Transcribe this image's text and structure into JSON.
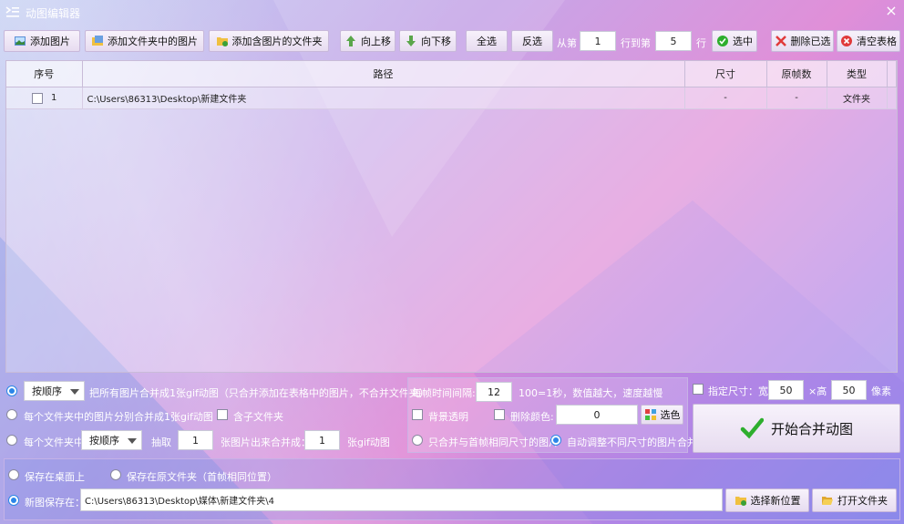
{
  "window": {
    "title": "动图编辑器"
  },
  "toolbar": {
    "add_image": "添加图片",
    "add_folder_images": "添加文件夹中的图片",
    "add_image_folders": "添加含图片的文件夹",
    "move_up": "向上移",
    "move_down": "向下移",
    "select_all": "全选",
    "invert": "反选",
    "from_label": "从第",
    "from_value": "1",
    "to_label": "行到第",
    "to_value": "5",
    "row_label": "行",
    "select_rows": "选中",
    "delete_selected": "删除已选",
    "clear_table": "清空表格"
  },
  "table": {
    "columns": [
      "序号",
      "路径",
      "尺寸",
      "原帧数",
      "类型"
    ],
    "rows": [
      {
        "index": "1",
        "path": "C:\\Users\\86313\\Desktop\\新建文件夹",
        "size": "-",
        "frames": "-",
        "type": "文件夹",
        "checked": false
      }
    ]
  },
  "merge": {
    "order_option": "按顺序",
    "mode1_text": "把所有图片合并成1张gif动图（只合并添加在表格中的图片，不合并文件夹）",
    "mode2_text": "每个文件夹中的图片分别合并成1张gif动图",
    "include_subfolders": "含子文件夹",
    "mode3_prefix": "每个文件夹中",
    "mode3_order": "按顺序",
    "take_label": "抽取",
    "take_value": "1",
    "per_merge_label": "张图片出来合并成：",
    "per_merge_value": "1",
    "gif_suffix": "张gif动图",
    "selected_mode": 1
  },
  "frames": {
    "interval_label": "每帧时间间隔:",
    "interval_value": "12",
    "interval_hint": "100=1秒，数值越大，速度越慢",
    "transparent_bg": "背景透明",
    "delete_color": "删除颜色:",
    "delete_color_value": "0",
    "pick_color": "选色",
    "same_size_only": "只合并与首帧相同尺寸的图片",
    "auto_adjust": "自动调整不同尺寸的图片合并"
  },
  "size": {
    "specify_label": "指定尺寸：宽",
    "width": "50",
    "height_label": "×高",
    "height": "50",
    "unit": "像素",
    "start_button": "开始合并动图"
  },
  "save": {
    "desktop": "保存在桌面上",
    "original_folder": "保存在原文件夹（首帧相同位置）",
    "new_path_label": "新图保存在：",
    "new_path": "C:\\Users\\86313\\Desktop\\媒体\\新建文件夹\\4",
    "choose_location": "选择新位置",
    "open_folder": "打开文件夹"
  },
  "colors": {
    "accent": "#2b86e8",
    "check_green": "#2eae2e",
    "delete_red": "#e03a3a"
  }
}
